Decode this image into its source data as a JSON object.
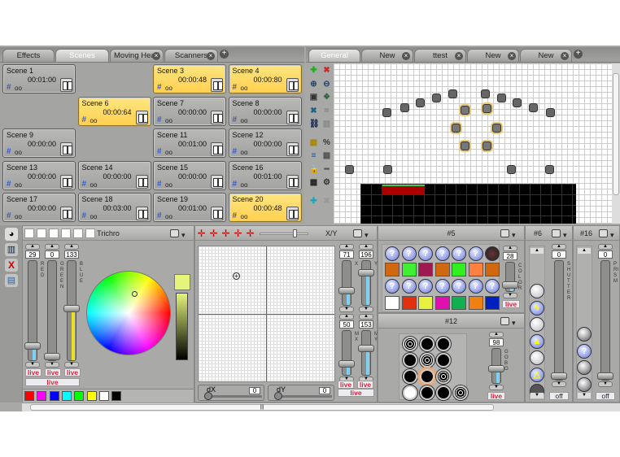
{
  "left_tabs": [
    {
      "label": "Effects",
      "active": false,
      "closable": false
    },
    {
      "label": "Scenes",
      "active": true,
      "closable": false
    },
    {
      "label": "Moving Head",
      "active": false,
      "closable": true
    },
    {
      "label": "Scanners",
      "active": false,
      "closable": true
    }
  ],
  "right_tabs": [
    {
      "label": "General",
      "active": true,
      "closable": false
    },
    {
      "label": "New",
      "active": false,
      "closable": true
    },
    {
      "label": "ttest",
      "active": false,
      "closable": true
    },
    {
      "label": "New",
      "active": false,
      "closable": true
    },
    {
      "label": "New",
      "active": false,
      "closable": true
    }
  ],
  "add_tab": "+",
  "scenes": [
    {
      "name": "Scene 1",
      "time": "00:01:00",
      "loop": "oo",
      "active": false,
      "col": 0,
      "row": 0
    },
    {
      "name": "Scene 3",
      "time": "00:00:48",
      "loop": "oo",
      "active": true,
      "col": 2,
      "row": 0
    },
    {
      "name": "Scene 4",
      "time": "00:00:80",
      "loop": "oo",
      "active": true,
      "col": 3,
      "row": 0
    },
    {
      "name": "Scene 6",
      "time": "00:00:64",
      "loop": "oo",
      "active": true,
      "col": 1,
      "row": 1
    },
    {
      "name": "Scene 7",
      "time": "00:00:00",
      "loop": "oo",
      "active": false,
      "col": 2,
      "row": 1
    },
    {
      "name": "Scene 8",
      "time": "00:00:00",
      "loop": "oo",
      "active": false,
      "col": 3,
      "row": 1
    },
    {
      "name": "Scene 9",
      "time": "00:00:00",
      "loop": "oo",
      "active": false,
      "col": 0,
      "row": 2
    },
    {
      "name": "Scene 11",
      "time": "00:01:00",
      "loop": "oo",
      "active": false,
      "col": 2,
      "row": 2
    },
    {
      "name": "Scene 12",
      "time": "00:00:00",
      "loop": "oo",
      "active": false,
      "col": 3,
      "row": 2
    },
    {
      "name": "Scene 13",
      "time": "00:00:00",
      "loop": "oo",
      "active": false,
      "col": 0,
      "row": 3
    },
    {
      "name": "Scene 14",
      "time": "00:00:00",
      "loop": "oo",
      "active": false,
      "col": 1,
      "row": 3
    },
    {
      "name": "Scene 15",
      "time": "00:00:00",
      "loop": "oo",
      "active": false,
      "col": 2,
      "row": 3
    },
    {
      "name": "Scene 16",
      "time": "00:01:00",
      "loop": "oo",
      "active": false,
      "col": 3,
      "row": 3
    },
    {
      "name": "Scene 17",
      "time": "00:00:00",
      "loop": "oo",
      "active": false,
      "col": 0,
      "row": 4
    },
    {
      "name": "Scene 18",
      "time": "00:03:00",
      "loop": "oo",
      "active": false,
      "col": 1,
      "row": 4
    },
    {
      "name": "Scene 19",
      "time": "00:01:00",
      "loop": "oo",
      "active": false,
      "col": 2,
      "row": 4
    },
    {
      "name": "Scene 20",
      "time": "00:00:48",
      "loop": "oo",
      "active": true,
      "col": 3,
      "row": 4
    }
  ],
  "stage_tools": [
    "add-fixture",
    "remove-fixture",
    "zoom-in",
    "zoom-out",
    "fit",
    "group",
    "tools",
    "clear",
    "link",
    "trash",
    "grid-a",
    "percent",
    "align",
    "grid-b",
    "lock",
    "line",
    "matrix",
    "gear",
    "add-blue",
    "remove-grey"
  ],
  "trichro": {
    "title": "Trichro",
    "sliders": [
      {
        "label": "RED",
        "value": 29,
        "color": "#7fd0f0"
      },
      {
        "label": "GREEN",
        "value": 0,
        "color": "#7fd0f0"
      },
      {
        "label": "BLUE",
        "value": 133,
        "color": "#e8e020"
      }
    ],
    "live": "live",
    "preview_color": "#e4f57a",
    "palette": [
      "#ff0000",
      "#ff00ff",
      "#0000ff",
      "#00ffff",
      "#00ff00",
      "#ffff00",
      "#ffffff",
      "#000000"
    ]
  },
  "xy": {
    "title": "X/Y",
    "sliders": [
      {
        "label": "X",
        "value": 71
      },
      {
        "label": "Y",
        "value": 196
      },
      {
        "label": "MX",
        "value": 50
      },
      {
        "label": "MY",
        "value": 153
      }
    ],
    "dx_label": "dX",
    "dx_value": "0",
    "dy_label": "dY",
    "dy_value": "0",
    "live": "live"
  },
  "color_panel": {
    "title": "#5",
    "slider": {
      "label": "COLOR",
      "value": 28
    },
    "live": "live",
    "row1": [
      "?",
      "?",
      "?",
      "?",
      "?",
      "?",
      "wheel"
    ],
    "swatches1": [
      "#d06810",
      "#40f030",
      "#a01850",
      "#d06810",
      "#30f020",
      "#ff8040",
      "#d06810"
    ],
    "row2": [
      "?",
      "?",
      "?",
      "?",
      "?",
      "?",
      "?"
    ],
    "swatches2": [
      "#ffffff",
      "#e03010",
      "#e8f040",
      "#e010b0",
      "#10b050",
      "#f08010",
      "#0020c0"
    ]
  },
  "gobo_panel": {
    "title": "#12",
    "slider": {
      "label": "GOBO",
      "value": 98
    },
    "live": "live"
  },
  "shutter_panel": {
    "title": "#6",
    "slider": {
      "label": "SHUTTER",
      "value": 0
    },
    "off": "off"
  },
  "prism_panel": {
    "title": "#16",
    "slider": {
      "label": "PRISM",
      "value": 0
    },
    "off": "off"
  },
  "scrollbar_grip": "|||",
  "live": "live"
}
